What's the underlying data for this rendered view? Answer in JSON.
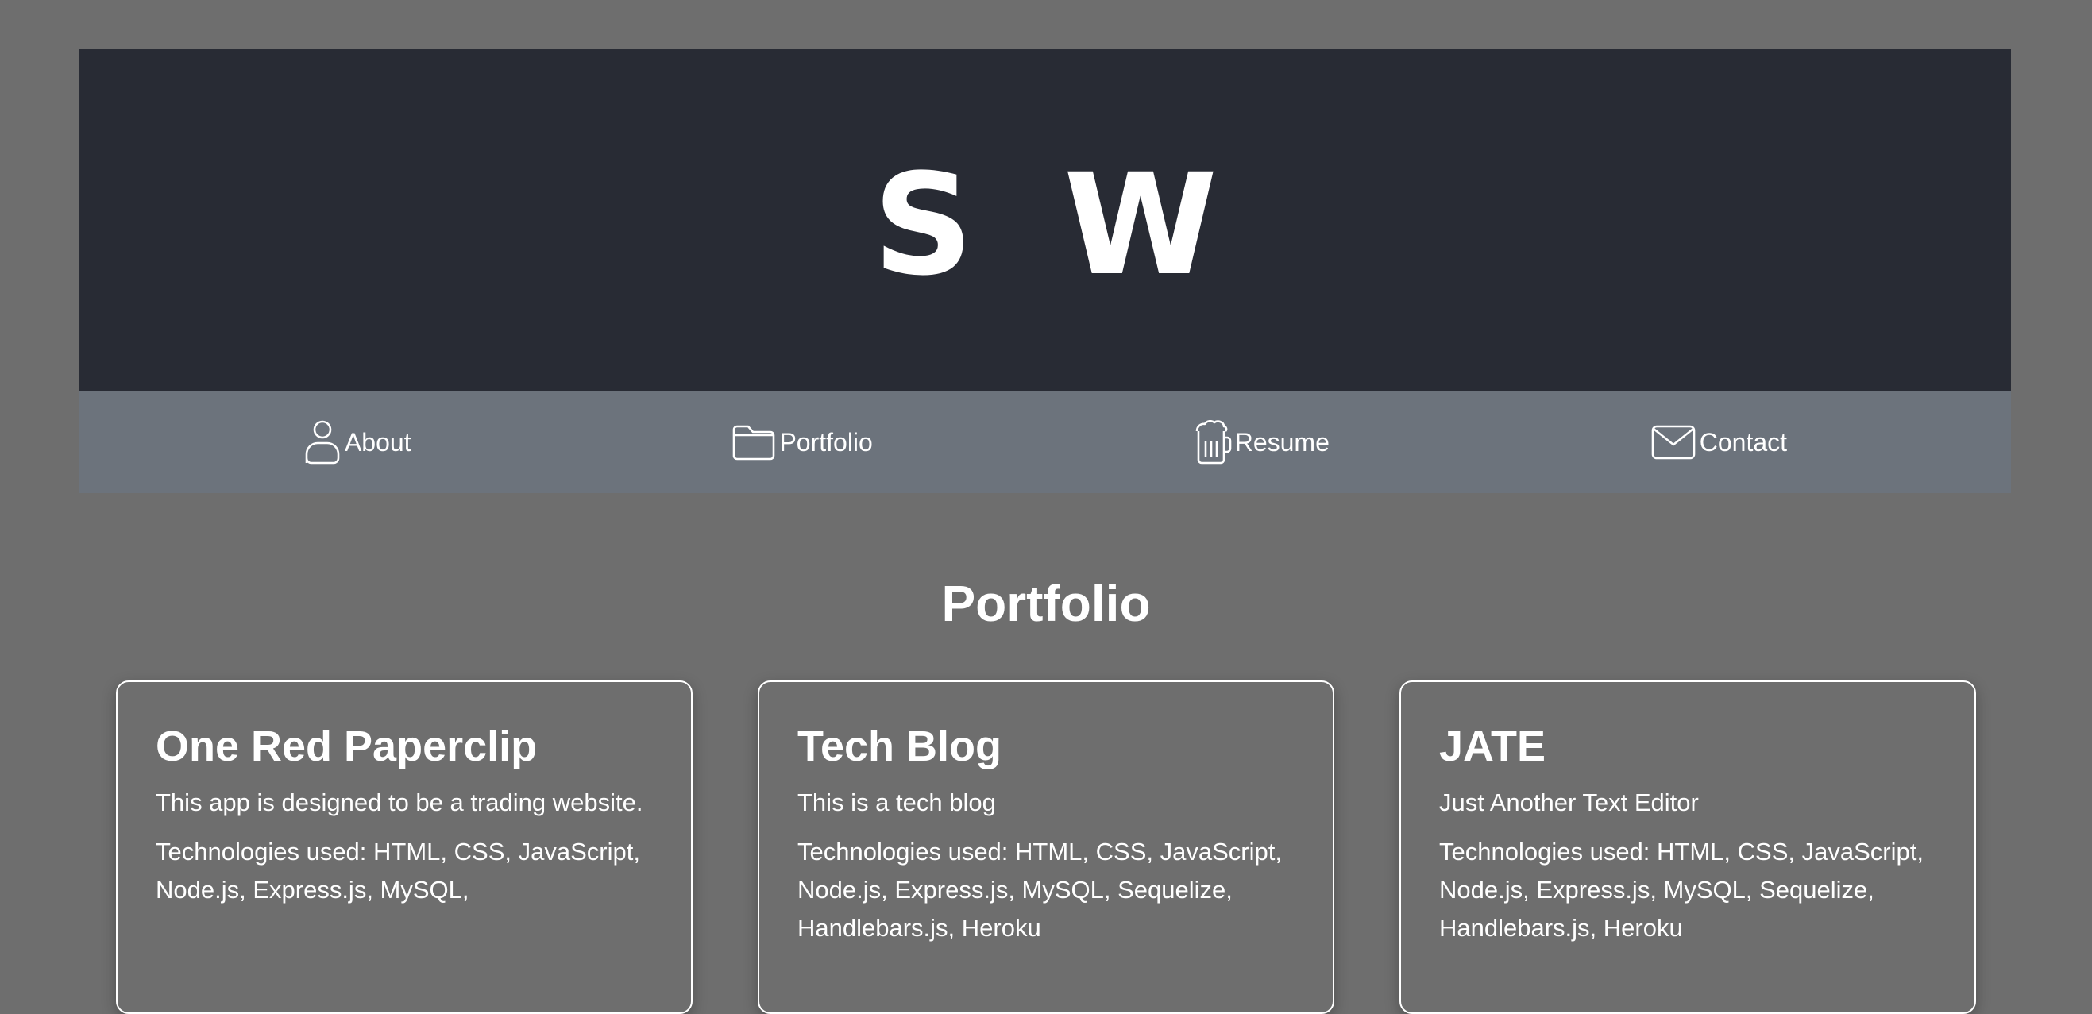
{
  "header": {
    "brand": "S W"
  },
  "nav": {
    "items": [
      {
        "label": "About",
        "icon": "person-icon"
      },
      {
        "label": "Portfolio",
        "icon": "folder-icon"
      },
      {
        "label": "Resume",
        "icon": "beer-mug-icon"
      },
      {
        "label": "Contact",
        "icon": "envelope-icon"
      }
    ]
  },
  "main": {
    "title": "Portfolio",
    "projects": [
      {
        "title": "One Red Paperclip",
        "description": "This app is designed to be a trading website.",
        "technologies": "Technologies used: HTML, CSS, JavaScript, Node.js, Express.js, MySQL,"
      },
      {
        "title": "Tech Blog",
        "description": "This is a tech blog",
        "technologies": "Technologies used: HTML, CSS, JavaScript, Node.js, Express.js, MySQL, Sequelize, Handlebars.js, Heroku"
      },
      {
        "title": "JATE",
        "description": "Just Another Text Editor",
        "technologies": "Technologies used: HTML, CSS, JavaScript, Node.js, Express.js, MySQL, Sequelize, Handlebars.js, Heroku"
      }
    ]
  },
  "colors": {
    "page_background": "#6e6e6e",
    "header_background": "#282b34",
    "nav_background": "#6c737c",
    "text": "#ffffff"
  }
}
